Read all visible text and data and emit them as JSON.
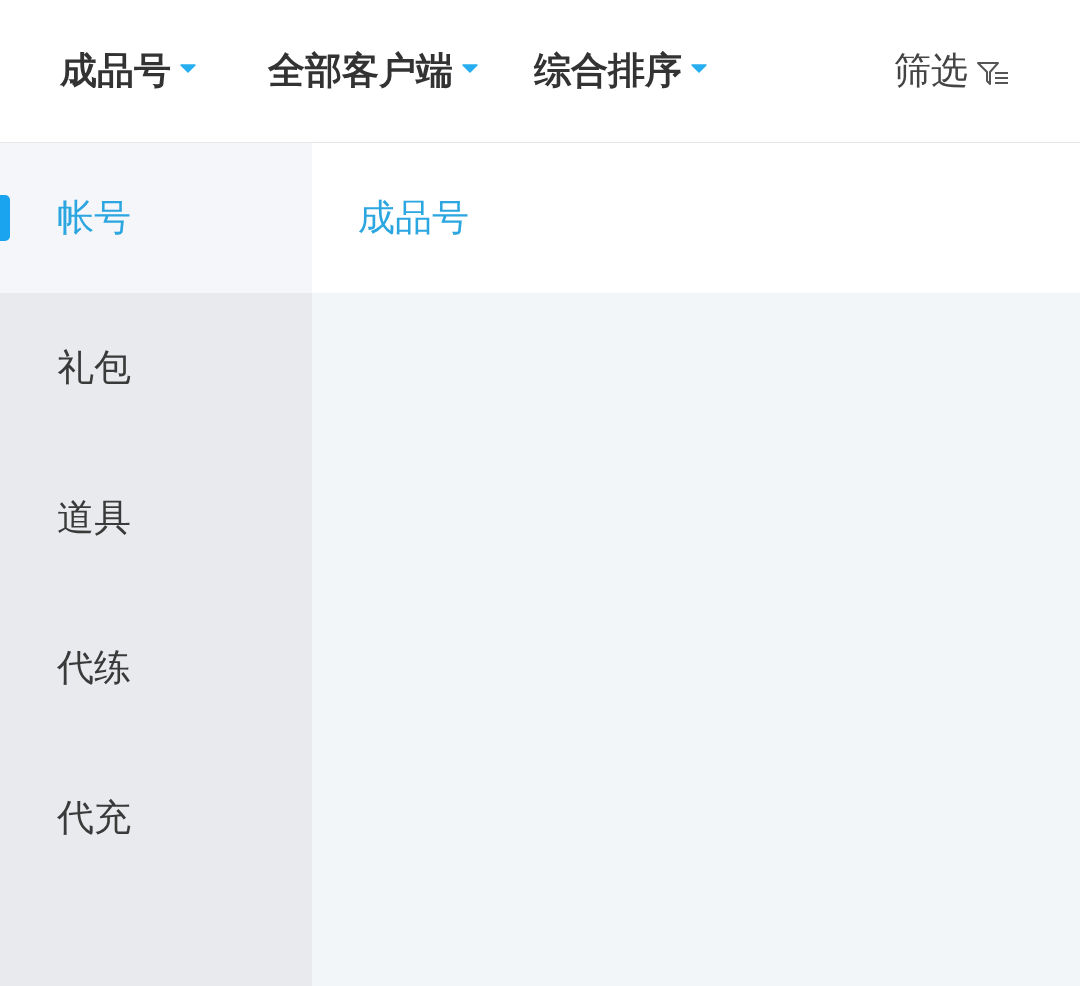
{
  "filter_bar": {
    "dropdowns": [
      {
        "label": "成品号"
      },
      {
        "label": "全部客户端"
      },
      {
        "label": "综合排序"
      }
    ],
    "filter_button": {
      "label": "筛选"
    }
  },
  "sidebar": {
    "items": [
      {
        "label": "帐号",
        "selected": true
      },
      {
        "label": "礼包",
        "selected": false
      },
      {
        "label": "道具",
        "selected": false
      },
      {
        "label": "代练",
        "selected": false
      },
      {
        "label": "代充",
        "selected": false
      }
    ]
  },
  "content": {
    "subcategories": [
      {
        "label": "成品号",
        "selected": true
      }
    ]
  }
}
